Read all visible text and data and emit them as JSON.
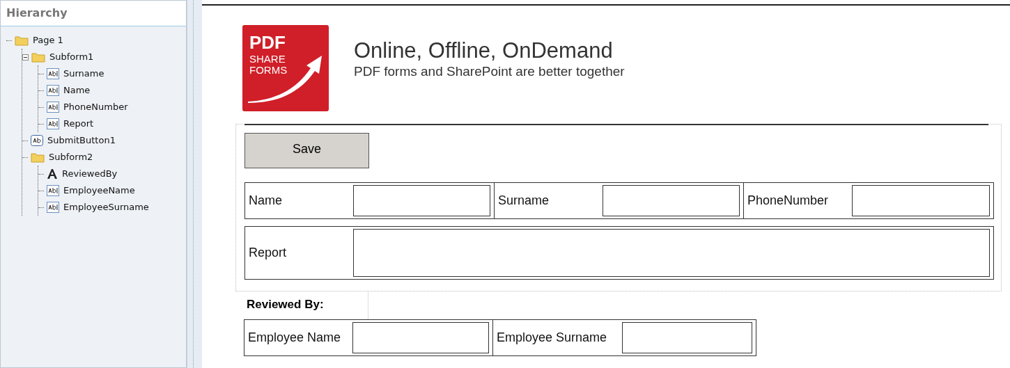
{
  "sidebar": {
    "title": "Hierarchy",
    "tree": [
      {
        "label": "Page 1",
        "kind": "folder",
        "children": [
          {
            "label": "Subform1",
            "kind": "folder",
            "expanded": true,
            "children": [
              {
                "label": "Surname",
                "kind": "field"
              },
              {
                "label": "Name",
                "kind": "field"
              },
              {
                "label": "PhoneNumber",
                "kind": "field"
              },
              {
                "label": "Report",
                "kind": "field"
              }
            ]
          },
          {
            "label": "SubmitButton1",
            "kind": "button"
          },
          {
            "label": "Subform2",
            "kind": "folder",
            "children": [
              {
                "label": "ReviewedBy",
                "kind": "text"
              },
              {
                "label": "EmployeeName",
                "kind": "field"
              },
              {
                "label": "EmployeeSurname",
                "kind": "field"
              }
            ]
          }
        ]
      }
    ]
  },
  "header": {
    "logo": [
      "PDF",
      "SHARE",
      "FORMS"
    ],
    "title": "Online, Offline, OnDemand",
    "subtitle": "PDF forms and SharePoint are better together"
  },
  "form": {
    "save_button": "Save",
    "rows": [
      {
        "fields": [
          "Name",
          "Surname",
          "PhoneNumber"
        ]
      },
      {
        "fields": [
          "Report"
        ]
      }
    ],
    "reviewed_label": "Reviewed By:",
    "reviewed_fields": [
      "Employee Name",
      "Employee Surname"
    ]
  }
}
